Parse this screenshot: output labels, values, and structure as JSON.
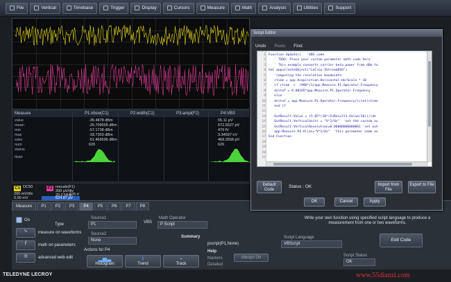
{
  "menubar": {
    "items": [
      {
        "label": "File",
        "icon": "file-icon"
      },
      {
        "label": "Vertical",
        "icon": "vertical-icon"
      },
      {
        "label": "Timebase",
        "icon": "timebase-icon"
      },
      {
        "label": "Trigger",
        "icon": "trigger-icon"
      },
      {
        "label": "Display",
        "icon": "display-icon"
      },
      {
        "label": "Cursors",
        "icon": "cursors-icon"
      },
      {
        "label": "Measure",
        "icon": "measure-icon"
      },
      {
        "label": "Math",
        "icon": "math-icon"
      },
      {
        "label": "Analysis",
        "icon": "analysis-icon"
      },
      {
        "label": "Utilities",
        "icon": "utilities-icon"
      },
      {
        "label": "Support",
        "icon": "support-icon"
      }
    ]
  },
  "colors": {
    "trace_yellow": "#e8d81a",
    "trace_pink": "#e23a9a",
    "histogram_green": "#4cd43a",
    "accent_blue": "#2a5fb8"
  },
  "measure": {
    "header_label": "Measure",
    "columns": [
      "P1:nbsw(C1)",
      "P2:width(C1)",
      "P3:ampl(F2)",
      "P4:VBS"
    ],
    "row_labels": [
      "value",
      "mean",
      "min",
      "max",
      "sdev",
      "num",
      "status"
    ],
    "p1_values": [
      "-35.4878 dBm",
      "-25.709005 dBm",
      "-57.1738 dBm",
      "-18.7303 dBm",
      "-51.469595 dBm",
      "626",
      ""
    ],
    "p4_values": [
      "55.11 pV",
      "572.5527 pV",
      "479 fV",
      "3.34597 nV",
      "468.2658 pV",
      "626",
      ""
    ],
    "histo_label": "histo"
  },
  "channels": {
    "c1": {
      "tag": "C1",
      "coupling": "DC50",
      "line1": "200 mV/div",
      "line2": "0.00 mV"
    },
    "f2": {
      "tag": "F2",
      "name": "rescale(F1)",
      "line1": "200 µV/div",
      "line2": "20.0 MHz",
      "line3": "625 #",
      "line4": "624.87 pV"
    }
  },
  "bottom": {
    "tabs": [
      "Measure",
      "P1",
      "P2",
      "P3",
      "P4",
      "P5",
      "P6",
      "P7",
      "P8"
    ],
    "active_tab": "P4",
    "on_label": "On",
    "type_label": "Type",
    "type_options": [
      "measure on waveforms",
      "math on parameters",
      "advanced web edit"
    ],
    "source1_label": "Source1",
    "source1_value": "P1",
    "source2_label": "Source2",
    "source2_value": "None",
    "vbs_label": "VBS",
    "math_operator_label": "Math Operator",
    "math_operator_value": "P Script",
    "summary_label": "Summary",
    "summary_value": "pscript(P1,None)",
    "actions_label": "Actions for P4",
    "action_buttons": [
      "Histogram",
      "Trend",
      "Track"
    ],
    "help_label": "Help",
    "help_markers": "Markers",
    "help_detailed": "Detailed",
    "always_on": "Always On",
    "description": "Write your own function using specified script language to produce a measurement from one or two waveforms.",
    "script_language_label": "Script Language",
    "script_language_value": "VBScript",
    "edit_code": "Edit Code",
    "script_status_label": "Script Status",
    "script_status_value": "OK"
  },
  "script_editor": {
    "title": "Script Editor",
    "menu": [
      "Undo",
      "Redo",
      "Find"
    ],
    "code_lines": [
      "Function Update()   'VBS code",
      "   ' TODO: Place your custom parameter math code here",
      "   ' This example converts carrier beta power from dBm to",
      "Set app=CreateObject(\"LeCroy.XStreamDSO\")",
      "   'computing the resolution bandwidth",
      "   ctime = app.Acquisition.Horizontal.HorScale * 10",
      "   if ctime  >  (990*(1/app.Measure.P1.Operator.Frequency",
      "   deltaf = 0.00105*app.Measure.P1.Operator.Frequency",
      "   else",
      "   deltaf = app.Measure.P1.Operator.Frequency/(cint(ctime",
      "   end if",
      "",
      "   OutResult.Value = (5.05*(10^(InResult1.Value/10))/(de",
      "   OutResult.VerticalUnits = \"V^2/Hz\"  'set the custom ou",
      "   OutResult.VerticalResolution=0.00000000000001 'set out",
      "   app.Measure.P4.Alias=\"V^2/Hz\"  'this parameter name ex",
      "End Function",
      "",
      "",
      "",
      ""
    ],
    "default_code": "Default Code",
    "status": "Status : OK",
    "import": "Import from File",
    "export": "Export to File",
    "ok": "OK",
    "cancel": "Cancel",
    "apply": "Apply"
  },
  "branding": {
    "logo": "TELEDYNE LECROY",
    "watermark": "www.55dianzi.com"
  }
}
